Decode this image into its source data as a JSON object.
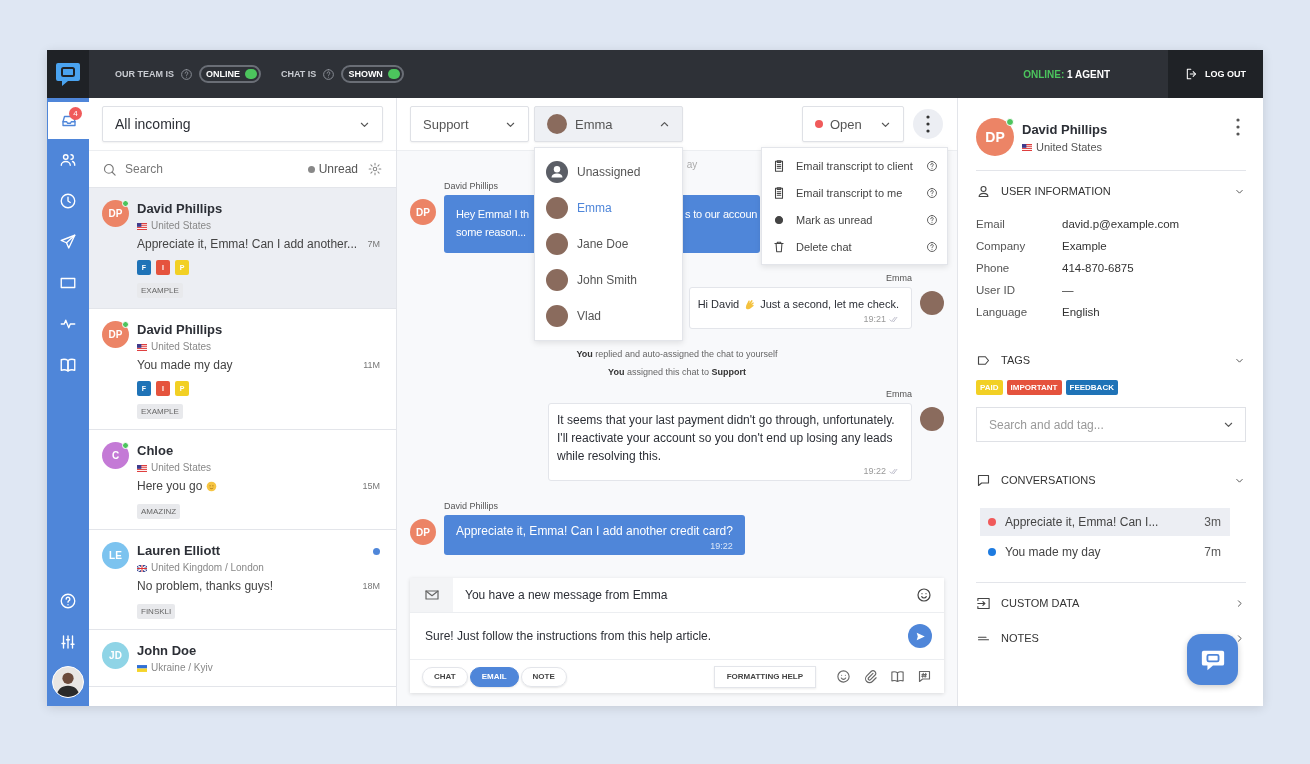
{
  "topbar": {
    "team_label": "OUR TEAM IS",
    "team_toggle": {
      "label": "ONLINE",
      "on": true
    },
    "chat_label": "CHAT IS",
    "chat_toggle": {
      "label": "SHOWN",
      "on": true
    },
    "online_label": "ONLINE:",
    "online_value": "1 AGENT",
    "logout": "LOG OUT"
  },
  "rail": {
    "items": [
      {
        "selected": true,
        "badge": "4"
      },
      {
        "selected": false
      },
      {
        "selected": false
      },
      {
        "selected": false
      },
      {
        "selected": false
      },
      {
        "selected": false
      },
      {
        "selected": false
      }
    ]
  },
  "list": {
    "filter": "All incoming",
    "search_placeholder": "Search",
    "unread_label": "Unread",
    "chats": [
      {
        "name": "David Phillips",
        "initials": "DP",
        "color": "#ec8466",
        "online": true,
        "flag": {
          "kind": "us"
        },
        "location": "United States",
        "preview": "Appreciate it, Emma! Can I add another...",
        "time": "7M",
        "unread": false,
        "badges": [
          {
            "letter": "F",
            "color": "#1f73b7"
          },
          {
            "letter": "I",
            "color": "#e5533d"
          },
          {
            "letter": "P",
            "color": "#f2d024"
          }
        ],
        "tag": "EXAMPLE",
        "selected": true
      },
      {
        "name": "David Phillips",
        "initials": "DP",
        "color": "#ec8466",
        "online": true,
        "flag": {
          "kind": "us"
        },
        "location": "United States",
        "preview": "You made my day",
        "time": "11M",
        "unread": false,
        "badges": [
          {
            "letter": "F",
            "color": "#1f73b7"
          },
          {
            "letter": "I",
            "color": "#e5533d"
          },
          {
            "letter": "P",
            "color": "#f2d024"
          }
        ],
        "tag": "EXAMPLE",
        "selected": false
      },
      {
        "name": "Chloe",
        "initials": "C",
        "color": "#c47ad6",
        "online": true,
        "flag": {
          "kind": "us"
        },
        "location": "United States",
        "preview": "Here you go",
        "emoji": {
          "kind": "smile"
        },
        "time": "15M",
        "unread": false,
        "tag": "AMAZINZ",
        "selected": false
      },
      {
        "name": "Lauren Elliott",
        "initials": "LE",
        "color": "#7cc3ef",
        "online": false,
        "flag": {
          "kind": "uk"
        },
        "location": "United Kingdom / London",
        "preview": "No problem, thanks guys!",
        "time": "18M",
        "unread": true,
        "tag": "FINSKLI",
        "selected": false
      },
      {
        "name": "John Doe",
        "initials": "JD",
        "color": "#8fd4e6",
        "online": false,
        "flag": {
          "kind": "ua"
        },
        "location": "Ukraine / Kyiv",
        "unread": false,
        "selected": false
      }
    ]
  },
  "chat": {
    "group": "Support",
    "assignee": "Emma",
    "assignee_expanded": true,
    "status": {
      "label": "Open",
      "color": "#f05a5a"
    },
    "assign_options": [
      {
        "name": "Unassigned",
        "avatar": {
          "kind": "generic"
        },
        "selected": false
      },
      {
        "name": "Emma",
        "avatar": {
          "kind": "photo"
        },
        "selected": true
      },
      {
        "name": "Jane Doe",
        "avatar": {
          "kind": "photo"
        },
        "selected": false
      },
      {
        "name": "John Smith",
        "avatar": {
          "kind": "photo"
        },
        "selected": false
      },
      {
        "name": "Vlad",
        "avatar": {
          "kind": "photo"
        },
        "selected": false
      }
    ],
    "actions": [
      {
        "label": "Email transcript to client"
      },
      {
        "label": "Email transcript to me"
      },
      {
        "label": "Mark as unread"
      },
      {
        "label": "Delete chat"
      }
    ],
    "date_fragment": "ay",
    "messages": [
      {
        "kind": "visitor_covered",
        "author": "David Phillips",
        "initials": "DP",
        "left_lines": [
          "Hey Emma! I th",
          "some reason..."
        ],
        "right_text": "s to our accoun"
      },
      {
        "kind": "agent",
        "author": "Emma",
        "text": "Hi David",
        "emoji": {
          "kind": "wave"
        },
        "text_after": "Just a second, let me check.",
        "time": "19:21"
      },
      {
        "kind": "system",
        "text": "**You** replied and auto-assigned the chat to yourself"
      },
      {
        "kind": "system",
        "text": "**You** assigned this chat to **Support**"
      },
      {
        "kind": "agent",
        "author": "Emma",
        "text": "It seems that your last payment didn't go through, unfortunately. I'll reactivate your account so you don't end up losing any leads while resolving this.",
        "time": "19:22"
      },
      {
        "kind": "visitor",
        "author": "David Phillips",
        "initials": "DP",
        "text": "Appreciate it, Emma! Can I add another credit card?",
        "time": "19:22"
      }
    ],
    "composer": {
      "subject": "You have a new message from Emma",
      "body": "Sure! Just follow the instructions from this help article.",
      "modes": [
        {
          "label": "CHAT",
          "selected": false
        },
        {
          "label": "EMAIL",
          "selected": true
        },
        {
          "label": "NOTE",
          "selected": false
        }
      ],
      "formatting": "FORMATTING HELP"
    }
  },
  "visitor": {
    "initials": "DP",
    "name": "David Phillips",
    "flag": {
      "kind": "us"
    },
    "location": "United States",
    "online": true,
    "sections": [
      {
        "kind": "info",
        "title": "USER INFORMATION",
        "expanded": true,
        "rows": [
          {
            "label": "Email",
            "value": "david.p@example.com"
          },
          {
            "label": "Company",
            "value": "Example"
          },
          {
            "label": "Phone",
            "value": "414-870-6875"
          },
          {
            "label": "User ID",
            "value": "—"
          },
          {
            "label": "Language",
            "value": "English"
          }
        ]
      },
      {
        "kind": "tags",
        "title": "TAGS",
        "expanded": true,
        "tags": [
          {
            "label": "PAID",
            "color": "#f2d024"
          },
          {
            "label": "IMPORTANT",
            "color": "#e5533d"
          },
          {
            "label": "FEEDBACK",
            "color": "#1f73b7"
          }
        ],
        "placeholder": "Search and add tag..."
      },
      {
        "kind": "conversations",
        "title": "CONVERSATIONS",
        "expanded": true,
        "items": [
          {
            "text": "Appreciate it, Emma! Can I...",
            "time": "3m",
            "color": "#f05a5a",
            "selected": true
          },
          {
            "text": "You made my day",
            "time": "7m",
            "color": "#1e7be0",
            "selected": false
          }
        ]
      },
      {
        "kind": "custom",
        "title": "CUSTOM DATA",
        "expanded": false
      },
      {
        "kind": "notes",
        "title": "NOTES",
        "expanded": false
      }
    ]
  }
}
